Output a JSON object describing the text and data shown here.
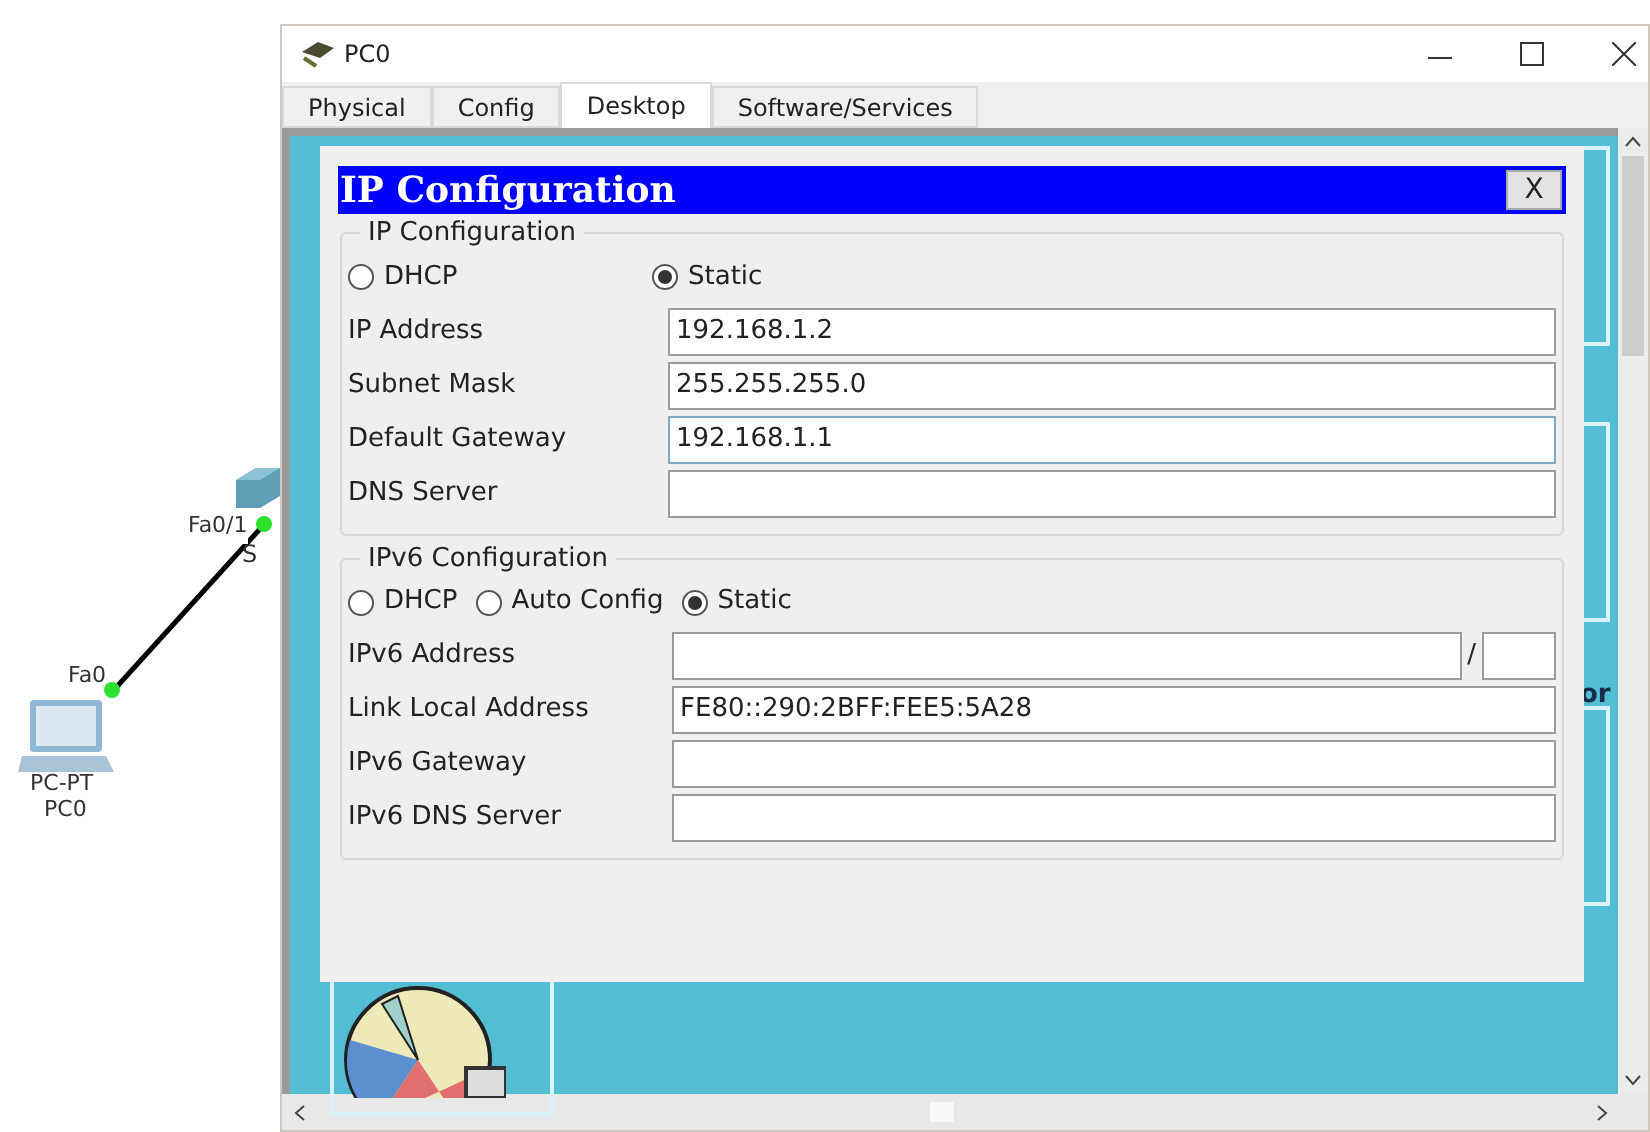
{
  "canvas": {
    "switch": {
      "port": "Fa0/1",
      "name": "S"
    },
    "pc": {
      "port": "Fa0",
      "model": "PC-PT",
      "name": "PC0"
    }
  },
  "window": {
    "title": "PC0"
  },
  "tabs": [
    {
      "label": "Physical",
      "selected": false
    },
    {
      "label": "Config",
      "selected": false
    },
    {
      "label": "Desktop",
      "selected": true
    },
    {
      "label": "Software/Services",
      "selected": false
    }
  ],
  "desktop": {
    "partial_label": "or"
  },
  "dialog": {
    "title": "IP Configuration",
    "close": "X",
    "ipv4": {
      "legend": "IP Configuration",
      "modes": [
        {
          "label": "DHCP",
          "selected": false
        },
        {
          "label": "Static",
          "selected": true
        }
      ],
      "fields": [
        {
          "label": "IP Address",
          "value": "192.168.1.2",
          "focused": false
        },
        {
          "label": "Subnet Mask",
          "value": "255.255.255.0",
          "focused": false
        },
        {
          "label": "Default Gateway",
          "value": "192.168.1.1",
          "focused": true
        },
        {
          "label": "DNS Server",
          "focused": false
        }
      ]
    },
    "ipv6": {
      "legend": "IPv6 Configuration",
      "modes": [
        {
          "label": "DHCP",
          "selected": false
        },
        {
          "label": "Auto Config",
          "selected": false
        },
        {
          "label": "Static",
          "selected": true
        }
      ],
      "fields": [
        {
          "label": "IPv6 Address",
          "kind": "prefixed",
          "separator": "/",
          "focused": false
        },
        {
          "label": "Link Local Address",
          "kind": "plain",
          "value": "FE80::290:2BFF:FEE5:5A28",
          "focused": false
        },
        {
          "label": "IPv6 Gateway",
          "kind": "plain",
          "focused": false
        },
        {
          "label": "IPv6 DNS Server",
          "kind": "plain",
          "focused": false
        }
      ]
    }
  }
}
